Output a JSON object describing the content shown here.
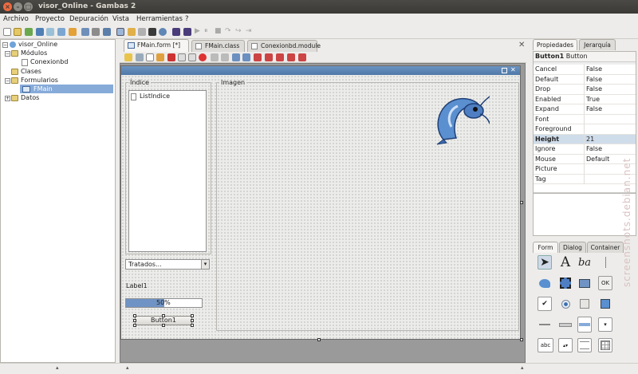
{
  "window": {
    "title": "visor_Online - Gambas 2"
  },
  "menu": [
    "Archivo",
    "Proyecto",
    "Depuración",
    "Vista",
    "Herramientas",
    "?"
  ],
  "project_tree": {
    "root": "visor_Online",
    "items": [
      {
        "label": "Módulos"
      },
      {
        "label": "Conexionbd"
      },
      {
        "label": "Clases"
      },
      {
        "label": "Formularios"
      },
      {
        "label": "FMain",
        "selected": true
      },
      {
        "label": "Datos"
      }
    ]
  },
  "editor_tabs": [
    {
      "label": "FMain.form [*]",
      "active": true
    },
    {
      "label": "FMain.class"
    },
    {
      "label": "Conexionbd.module"
    }
  ],
  "form": {
    "indice_label": "Índice",
    "list_item": "ListIndice",
    "imagen_label": "Imagen",
    "combo_value": "Tratados...",
    "label1": "Label1",
    "progress_value": 0.5,
    "progress_text": "50%",
    "button1": "Button1"
  },
  "right_tabs": [
    "Propiedades",
    "Jerarquía"
  ],
  "properties": {
    "header_name": "Button1",
    "header_type": "Button",
    "rows": [
      {
        "name": "Cancel",
        "value": "False"
      },
      {
        "name": "Default",
        "value": "False"
      },
      {
        "name": "Drop",
        "value": "False"
      },
      {
        "name": "Enabled",
        "value": "True"
      },
      {
        "name": "Expand",
        "value": "False"
      },
      {
        "name": "Font",
        "value": ""
      },
      {
        "name": "Foreground",
        "value": ""
      },
      {
        "name": "Height",
        "value": "21",
        "selected": true
      },
      {
        "name": "Ignore",
        "value": "False"
      },
      {
        "name": "Mouse",
        "value": "Default"
      },
      {
        "name": "Picture",
        "value": ""
      },
      {
        "name": "Tag",
        "value": ""
      }
    ]
  },
  "toolbox_tabs": [
    "Form",
    "Dialog",
    "Container"
  ],
  "toolbox": {
    "text_icon": "A",
    "ok_label": "OK",
    "abc_label": "abc"
  },
  "watermark": "screenshots.debian.net",
  "colors": {
    "selection": "#86abd9",
    "form_header": "#5d86b8",
    "titlebar": "#3c3b37"
  }
}
